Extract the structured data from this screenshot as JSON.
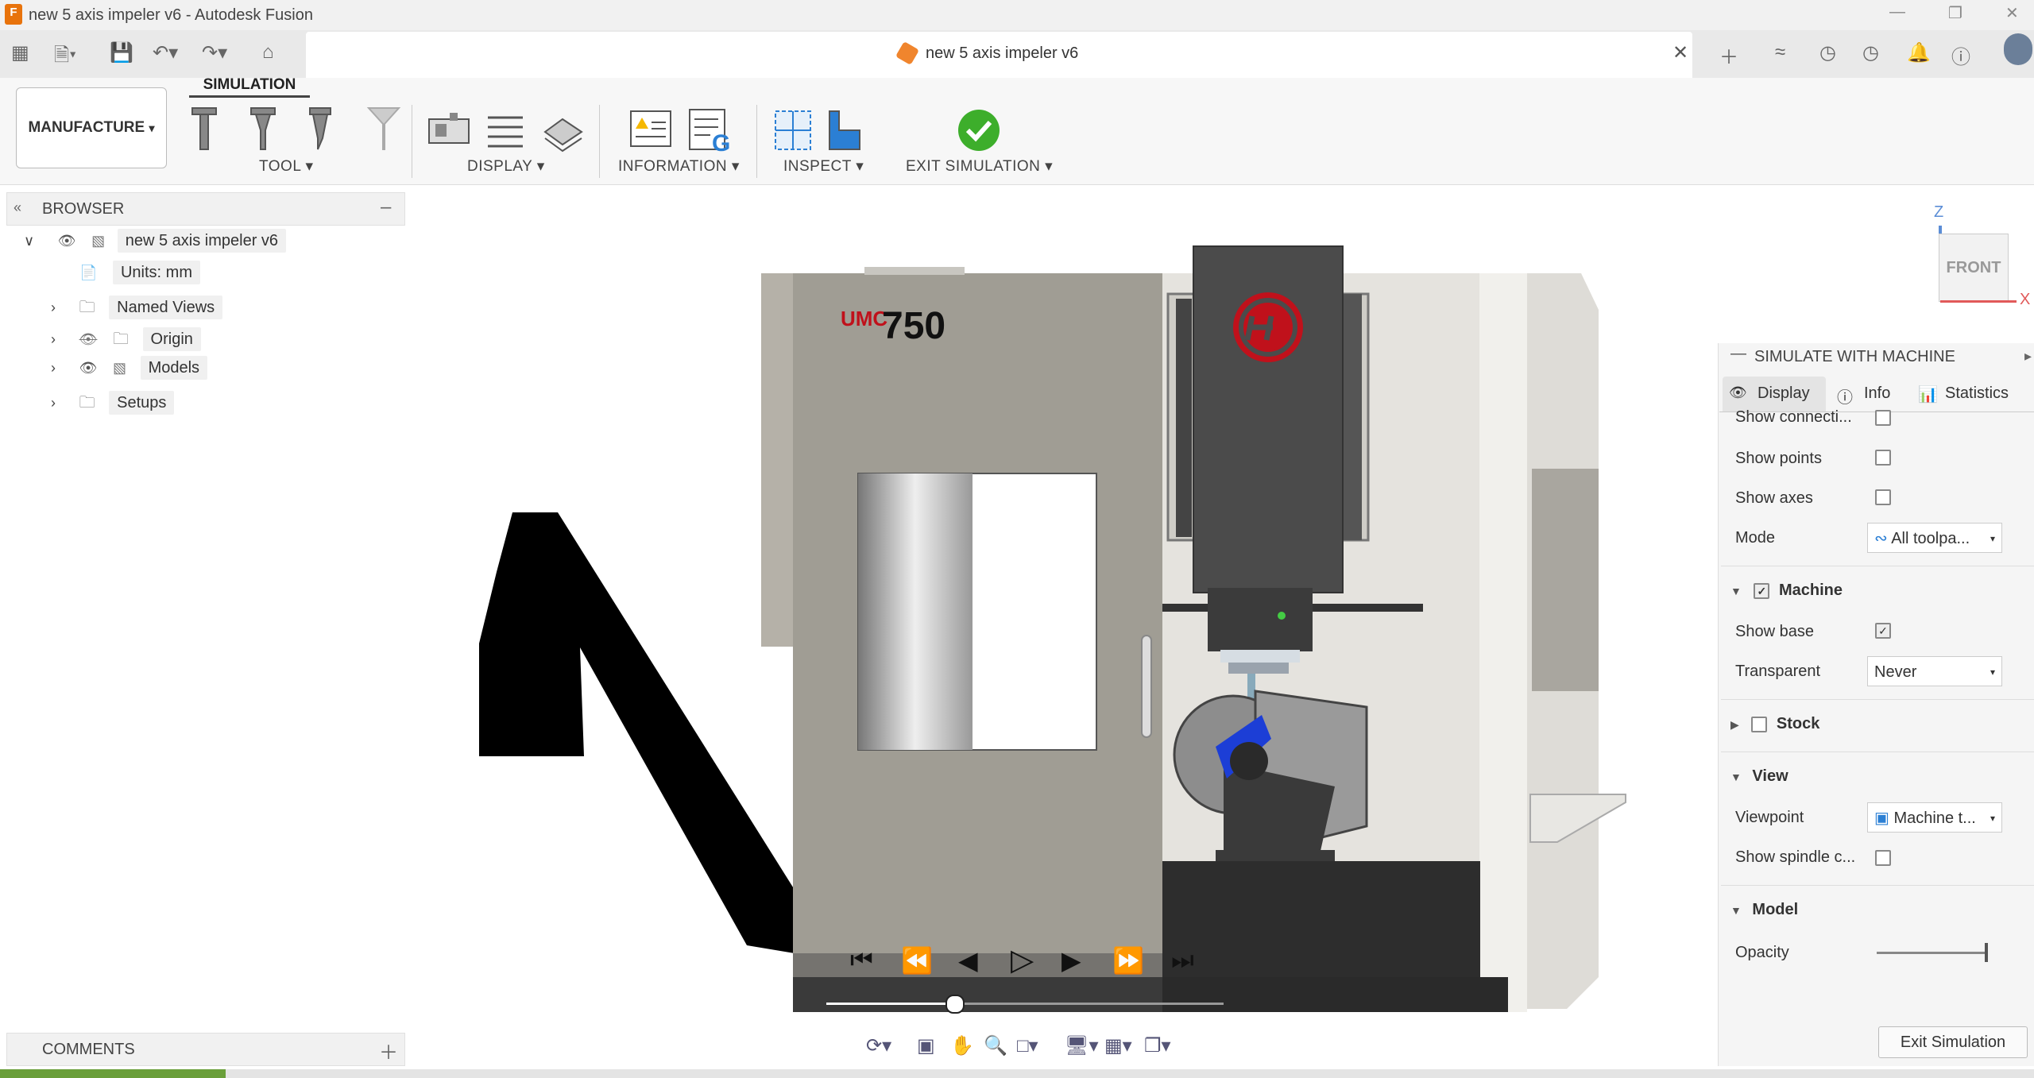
{
  "window": {
    "title": "new 5 axis impeler v6 - Autodesk Fusion",
    "app_icon": "F"
  },
  "tab": {
    "label": "new 5 axis impeler v6"
  },
  "ribbon": {
    "workspace": "MANUFACTURE",
    "active_tab": "SIMULATION",
    "groups": {
      "tool": "TOOL",
      "display": "DISPLAY",
      "information": "INFORMATION",
      "inspect": "INSPECT",
      "exit": "EXIT SIMULATION"
    }
  },
  "browser": {
    "title": "BROWSER",
    "root": "new 5 axis impeler v6",
    "items": [
      "Units: mm",
      "Named Views",
      "Origin",
      "Models",
      "Setups"
    ]
  },
  "comments": {
    "title": "COMMENTS"
  },
  "viewcube": {
    "face": "FRONT",
    "z": "Z",
    "x": "X"
  },
  "machine": {
    "model_prefix": "UMC",
    "model_number": "750"
  },
  "panel": {
    "title": "SIMULATE WITH MACHINE",
    "tabs": [
      "Display",
      "Info",
      "Statistics"
    ],
    "rows": {
      "show_connections": "Show connecti...",
      "show_points": "Show points",
      "show_axes": "Show axes",
      "mode": "Mode",
      "mode_value": "All toolpa...",
      "machine": "Machine",
      "show_base": "Show base",
      "transparent": "Transparent",
      "transparent_value": "Never",
      "stock": "Stock",
      "view": "View",
      "viewpoint": "Viewpoint",
      "viewpoint_value": "Machine t...",
      "show_spindle": "Show spindle c...",
      "model": "Model",
      "opacity": "Opacity"
    },
    "opacity_level": 1.0,
    "exit_button": "Exit Simulation"
  },
  "playback": {
    "progress": 0.32
  }
}
